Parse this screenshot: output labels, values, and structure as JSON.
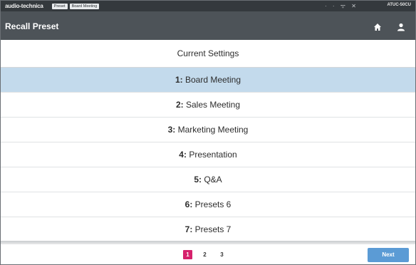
{
  "status_bar": {
    "brand": "audio-technica",
    "chips": [
      "Preset",
      "Board Meeting"
    ],
    "icons": "· · ᯤ ✕",
    "device_id": "ATUC-50CU"
  },
  "header": {
    "title": "Recall Preset",
    "icons": [
      "home-icon",
      "user-icon"
    ]
  },
  "current_settings_label": "Current Settings",
  "presets": [
    {
      "num": "1:",
      "name": "Board Meeting",
      "selected": true
    },
    {
      "num": "2:",
      "name": "Sales Meeting",
      "selected": false
    },
    {
      "num": "3:",
      "name": "Marketing Meeting",
      "selected": false
    },
    {
      "num": "4:",
      "name": "Presentation",
      "selected": false
    },
    {
      "num": "5:",
      "name": "Q&A",
      "selected": false
    },
    {
      "num": "6:",
      "name": "Presets 6",
      "selected": false
    },
    {
      "num": "7:",
      "name": "Presets 7",
      "selected": false
    }
  ],
  "pagination": {
    "pages": [
      "1",
      "2",
      "3"
    ],
    "current_page": "1",
    "next_label": "Next"
  },
  "colors": {
    "status_bar": "#34393d",
    "title_bar": "#4d5358",
    "selected_row": "#c3daec",
    "active_page": "#d6216c",
    "next_button": "#5b9bd5"
  }
}
